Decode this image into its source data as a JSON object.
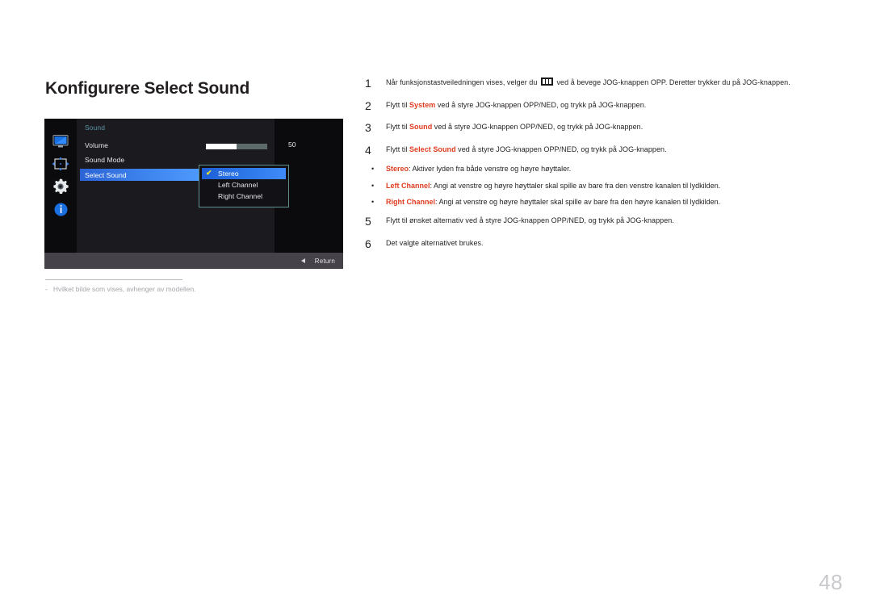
{
  "document": {
    "title": "Konfigurere Select Sound",
    "page_number": "48"
  },
  "osd": {
    "menu_title": "Sound",
    "sidebar_icons": [
      {
        "name": "picture-icon",
        "label": "Picture"
      },
      {
        "name": "screen-adjust-icon",
        "label": "Screen Adjustment"
      },
      {
        "name": "gear-icon",
        "label": "System"
      },
      {
        "name": "info-icon",
        "label": "Information"
      }
    ],
    "rows": [
      {
        "label": "Volume",
        "value": "50"
      },
      {
        "label": "Sound Mode",
        "value": ""
      },
      {
        "label": "Select Sound",
        "value": ""
      }
    ],
    "volume_label": "Volume",
    "volume_value": "50",
    "volume_percent": 50,
    "sound_mode_label": "Sound Mode",
    "select_sound_label": "Select Sound",
    "popup_options": [
      {
        "label": "Stereo",
        "selected": true
      },
      {
        "label": "Left Channel",
        "selected": false
      },
      {
        "label": "Right Channel",
        "selected": false
      }
    ],
    "return_label": "Return",
    "colors": {
      "highlight_blue": "#3f86ef",
      "popup_border": "#61918e",
      "title_teal": "#5b93a8",
      "check_yellow": "#e8e42a",
      "return_bar": "#46424a"
    }
  },
  "footnote": {
    "dash": "-",
    "text": "Hvilket bilde som vises, avhenger av modellen."
  },
  "steps": [
    {
      "num": "1",
      "pre": "Når funksjonstastveiledningen vises, velger du ",
      "has_glyph": true,
      "post": " ved å bevege JOG-knappen OPP. Deretter trykker du på JOG-knappen."
    },
    {
      "num": "2",
      "pre": "Flytt til ",
      "highlight": "System",
      "post": " ved å styre JOG-knappen OPP/NED, og trykk på JOG-knappen."
    },
    {
      "num": "3",
      "pre": "Flytt til ",
      "highlight": "Sound",
      "post": " ved å styre JOG-knappen OPP/NED, og trykk på JOG-knappen."
    },
    {
      "num": "4",
      "pre": "Flytt til ",
      "highlight": "Select Sound",
      "post": " ved å styre JOG-knappen OPP/NED, og trykk på JOG-knappen."
    }
  ],
  "bullets": [
    {
      "dot": "•",
      "highlight": "Stereo",
      "text": ": Aktiver lyden fra både venstre og høyre høyttaler."
    },
    {
      "dot": "•",
      "highlight": "Left Channel",
      "text": ": Angi at venstre og høyre høyttaler skal spille av bare fra den venstre kanalen til lydkilden."
    },
    {
      "dot": "•",
      "highlight": "Right Channel",
      "text": ": Angi at venstre og høyre høyttaler skal spille av bare fra den høyre kanalen til lydkilden."
    }
  ],
  "steps_tail": [
    {
      "num": "5",
      "pre": "Flytt til ønsket alternativ ved å styre JOG-knappen OPP/NED, og trykk på JOG-knappen.",
      "highlight": "",
      "post": ""
    },
    {
      "num": "6",
      "pre": "Det valgte alternativet brukes.",
      "highlight": "",
      "post": ""
    }
  ]
}
